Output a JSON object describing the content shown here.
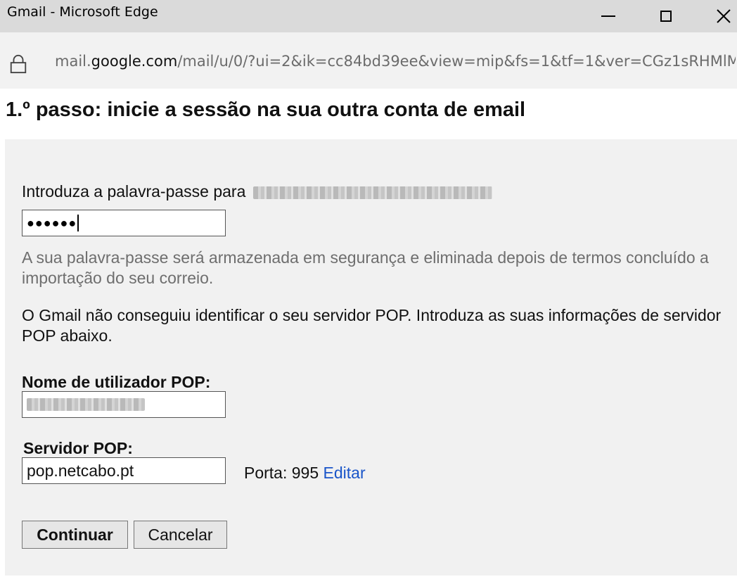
{
  "window": {
    "title": "Gmail - Microsoft Edge"
  },
  "address": {
    "host_prefix": "mail.",
    "host_domain": "google.com",
    "path": "/mail/u/0/?ui=2&ik=cc84bd39ee&view=mip&fs=1&tf=1&ver=CGz1sRHMlM"
  },
  "page": {
    "heading": "1.º passo: inicie a sessão na sua outra conta de email"
  },
  "form": {
    "password_prompt": "Introduza a palavra-passe para",
    "password_dots": "●●●●●●",
    "password_note": "A sua palavra-passe será armazenada em segurança e eliminada depois de termos concluído a importação do seu correio.",
    "pop_not_found": "O Gmail não conseguiu identificar o seu servidor POP. Introduza as suas informações de servidor POP abaixo.",
    "username_label": "Nome de utilizador POP:",
    "server_label": "Servidor POP:",
    "server_value": "pop.netcabo.pt",
    "port_text": "Porta: 995",
    "edit_link": "Editar",
    "continue_label": "Continuar",
    "cancel_label": "Cancelar"
  }
}
